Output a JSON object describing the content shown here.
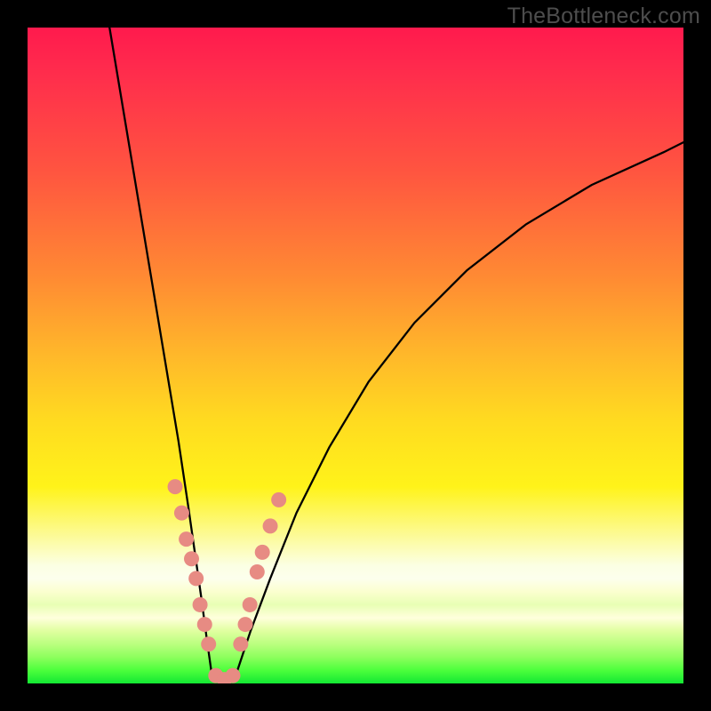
{
  "watermark": {
    "text": "TheBottleneck.com"
  },
  "colors": {
    "frame": "#000000",
    "curve_stroke": "#000000",
    "marker_fill": "#e78b83",
    "marker_stroke": "#d2776f"
  },
  "chart_data": {
    "type": "line",
    "title": "",
    "xlabel": "",
    "ylabel": "",
    "xlim": [
      0,
      100
    ],
    "ylim": [
      0,
      100
    ],
    "grid": false,
    "series": [
      {
        "name": "left-arm",
        "x": [
          12.5,
          14,
          15.5,
          17,
          18.5,
          20,
          21.5,
          23,
          24.5,
          25.5,
          26.5,
          27.3,
          28
        ],
        "y": [
          100,
          91,
          82,
          73,
          64,
          55,
          46,
          37,
          27,
          20,
          13,
          7,
          2
        ]
      },
      {
        "name": "right-arm",
        "x": [
          32,
          34,
          37,
          41,
          46,
          52,
          59,
          67,
          76,
          86,
          97,
          100
        ],
        "y": [
          2,
          8,
          16,
          26,
          36,
          46,
          55,
          63,
          70,
          76,
          81,
          82.5
        ]
      },
      {
        "name": "bottom",
        "x": [
          28,
          29,
          30,
          31,
          32
        ],
        "y": [
          2,
          0.6,
          0.3,
          0.6,
          2
        ]
      }
    ],
    "markers": [
      {
        "x": 22.5,
        "y": 30
      },
      {
        "x": 23.5,
        "y": 26
      },
      {
        "x": 24.2,
        "y": 22
      },
      {
        "x": 25.0,
        "y": 19
      },
      {
        "x": 25.7,
        "y": 16
      },
      {
        "x": 26.3,
        "y": 12
      },
      {
        "x": 27.0,
        "y": 9
      },
      {
        "x": 27.6,
        "y": 6
      },
      {
        "x": 28.7,
        "y": 1.2
      },
      {
        "x": 30.0,
        "y": 0.6
      },
      {
        "x": 31.3,
        "y": 1.2
      },
      {
        "x": 32.5,
        "y": 6
      },
      {
        "x": 33.2,
        "y": 9
      },
      {
        "x": 33.9,
        "y": 12
      },
      {
        "x": 35.0,
        "y": 17
      },
      {
        "x": 35.8,
        "y": 20
      },
      {
        "x": 37.0,
        "y": 24
      },
      {
        "x": 38.3,
        "y": 28
      }
    ]
  }
}
